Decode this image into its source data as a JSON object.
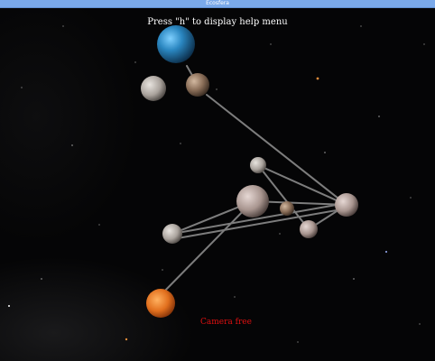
{
  "window": {
    "title": "Ecosfera"
  },
  "overlay": {
    "help_hint": "Press \"h\" to display help menu",
    "camera_status": "Camera free"
  },
  "colors": {
    "background": "#050506",
    "titlebar": "#7aa9ea",
    "help_text": "#ffffff",
    "camera_text": "#e01010",
    "link": "#8a8a8a"
  },
  "scene": {
    "bodies": [
      {
        "name": "blue-planet",
        "kind": "planet",
        "color": "#2a86c0"
      },
      {
        "name": "grey-moon-left",
        "kind": "moon",
        "color": "#b9b5b0"
      },
      {
        "name": "brown-moon",
        "kind": "moon",
        "color": "#8a6e58"
      },
      {
        "name": "small-moon-top",
        "kind": "moon",
        "color": "#c4bdb6"
      },
      {
        "name": "large-moon-center",
        "kind": "moon",
        "color": "#b8aaa4"
      },
      {
        "name": "small-brown-moon",
        "kind": "moon",
        "color": "#9a8070"
      },
      {
        "name": "right-moon",
        "kind": "moon",
        "color": "#b8aaa8"
      },
      {
        "name": "lower-moon-right",
        "kind": "moon",
        "color": "#b3a9a6"
      },
      {
        "name": "left-moon",
        "kind": "moon",
        "color": "#aaa5a2"
      },
      {
        "name": "orange-planet",
        "kind": "planet",
        "color": "#e2701e"
      }
    ]
  }
}
